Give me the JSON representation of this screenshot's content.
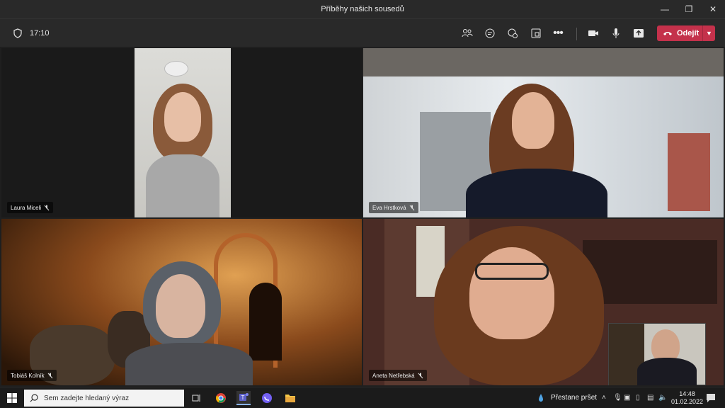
{
  "window": {
    "title": "Příběhy našich sousedů",
    "controls": [
      "minimize",
      "restore",
      "close"
    ]
  },
  "meeting": {
    "timer": "17:10",
    "toolbar_icons": [
      "people-icon",
      "chat-icon",
      "reactions-icon",
      "rooms-icon",
      "more-icon",
      "camera-icon",
      "mic-icon",
      "share-icon"
    ],
    "leave_label": "Odejít"
  },
  "participants": [
    {
      "name": "Laura Miceli",
      "muted": true
    },
    {
      "name": "Eva Hrstková",
      "muted": true
    },
    {
      "name": "Tobiáš Kolník",
      "muted": true
    },
    {
      "name": "Aneta Netřebská",
      "muted": true
    }
  ],
  "taskbar": {
    "search_placeholder": "Sem zadejte hledaný výraz",
    "weather": "Přestane pršet",
    "time": "14:48",
    "date": "01.02.2022"
  }
}
